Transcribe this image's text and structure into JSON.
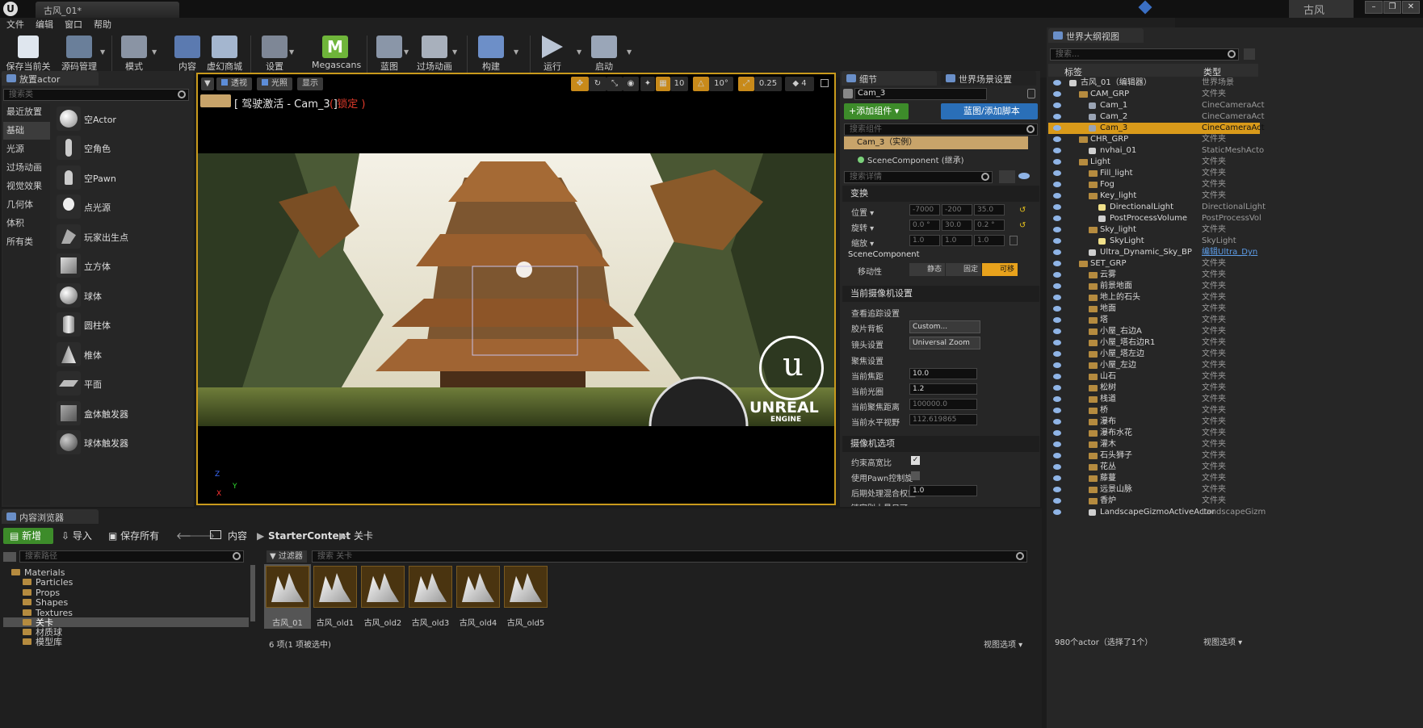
{
  "window": {
    "doc_tab": "古风_01*",
    "project_name": "古风"
  },
  "menu": [
    "文件",
    "编辑",
    "窗口",
    "帮助"
  ],
  "toolbar": [
    {
      "label": "保存当前关卡",
      "icon": "save-icon"
    },
    {
      "label": "源码管理",
      "icon": "source-control-icon"
    },
    {
      "label": "模式",
      "icon": "modes-icon"
    },
    {
      "label": "内容",
      "icon": "content-icon"
    },
    {
      "label": "虚幻商城",
      "icon": "marketplace-icon"
    },
    {
      "label": "设置",
      "icon": "settings-icon"
    },
    {
      "label": "Megascans",
      "icon": "megascans-icon"
    },
    {
      "label": "蓝图",
      "icon": "blueprint-icon"
    },
    {
      "label": "过场动画",
      "icon": "cinematics-icon"
    },
    {
      "label": "构建",
      "icon": "build-icon"
    },
    {
      "label": "运行",
      "icon": "play-icon"
    },
    {
      "label": "启动",
      "icon": "launch-icon"
    }
  ],
  "place_actor": {
    "tab": "放置actor",
    "search_placeholder": "搜索类",
    "categories": [
      "最近放置",
      "基础",
      "光源",
      "过场动画",
      "视觉效果",
      "几何体",
      "体积",
      "所有类"
    ],
    "actors": [
      "空Actor",
      "空角色",
      "空Pawn",
      "点光源",
      "玩家出生点",
      "立方体",
      "球体",
      "圆柱体",
      "椎体",
      "平面",
      "盒体触发器",
      "球体触发器"
    ]
  },
  "viewport": {
    "buttons": [
      "透视",
      "光照",
      "显示"
    ],
    "pilot_label": "[ 驾驶激活 - Cam_3 ]",
    "locked_label": "( 锁定 )",
    "grid_snap": "10",
    "rot_snap": "10°",
    "scale_snap": "0.25",
    "cam_speed": "4",
    "logo_text": "UNREAL",
    "logo_sub": "ENGINE",
    "axis_z": "Z",
    "axis_y": "Y",
    "axis_x": "X"
  },
  "details": {
    "tab_details": "细节",
    "tab_world": "世界场景设置",
    "name_value": "Cam_3",
    "add_component": "+添加组件 ▾",
    "blueprint_btn": "蓝图/添加脚本",
    "search_components": "搜索组件",
    "instance": "Cam_3（实例）",
    "scene_component": "SceneComponent (继承)",
    "search_details": "搜索详情",
    "transform": "变换",
    "position_label": "位置 ▾",
    "rotation_label": "旋转 ▾",
    "scale_label": "缩放 ▾",
    "pos": [
      "-7000",
      "-200",
      "35.0"
    ],
    "rot": [
      "0.0 °",
      "30.0",
      "0.2 °"
    ],
    "scale": [
      "1.0",
      "1.0",
      "1.0"
    ],
    "scene_comp_section": "SceneComponent",
    "mobility": "移动性",
    "mob_static": "静态",
    "mob_stationary": "固定",
    "mob_movable": "可移",
    "cam_settings": "当前摄像机设置",
    "lookat": "查看追踪设置",
    "filmback": "胶片背板",
    "filmback_val": "Custom...",
    "lens": "镜头设置",
    "lens_val": "Universal Zoom",
    "focus": "聚焦设置",
    "focal_len": "当前焦距",
    "focal_len_val": "10.0",
    "aperture": "当前光圈",
    "aperture_val": "1.2",
    "focus_dist": "当前聚焦距离",
    "focus_dist_val": "100000.0",
    "hfov": "当前水平视野",
    "hfov_val": "112.619865",
    "cam_options": "摄像机选项",
    "constrain": "约束高宽比",
    "use_pawn": "使用Pawn控制旋",
    "pp_blend": "后期处理混合权重",
    "pp_blend_val": "1.0",
    "cut_label": "链家别士量日可"
  },
  "outliner": {
    "tab": "世界大纲视图",
    "search_placeholder": "搜索...",
    "col_label": "标签",
    "col_type": "类型",
    "rows": [
      {
        "label": "古风_01（编辑器）",
        "type": "世界场景",
        "depth": 0,
        "kind": "world"
      },
      {
        "label": "CAM_GRP",
        "type": "文件夹",
        "depth": 1,
        "kind": "folder"
      },
      {
        "label": "Cam_1",
        "type": "CineCameraAct",
        "depth": 2,
        "kind": "camera"
      },
      {
        "label": "Cam_2",
        "type": "CineCameraAct",
        "depth": 2,
        "kind": "camera"
      },
      {
        "label": "Cam_3",
        "type": "CineCameraAct",
        "depth": 2,
        "kind": "camera",
        "selected": true
      },
      {
        "label": "CHR_GRP",
        "type": "文件夹",
        "depth": 1,
        "kind": "folder"
      },
      {
        "label": "nvhai_01",
        "type": "StaticMeshActo",
        "depth": 2,
        "kind": "mesh"
      },
      {
        "label": "Light",
        "type": "文件夹",
        "depth": 1,
        "kind": "folder"
      },
      {
        "label": "Fill_light",
        "type": "文件夹",
        "depth": 2,
        "kind": "folder"
      },
      {
        "label": "Fog",
        "type": "文件夹",
        "depth": 2,
        "kind": "folder"
      },
      {
        "label": "Key_light",
        "type": "文件夹",
        "depth": 2,
        "kind": "folder"
      },
      {
        "label": "DirectionalLight",
        "type": "DirectionalLight",
        "depth": 3,
        "kind": "light"
      },
      {
        "label": "PostProcessVolume",
        "type": "PostProcessVol",
        "depth": 3,
        "kind": "pp"
      },
      {
        "label": "Sky_light",
        "type": "文件夹",
        "depth": 2,
        "kind": "folder"
      },
      {
        "label": "SkyLight",
        "type": "SkyLight",
        "depth": 3,
        "kind": "light"
      },
      {
        "label": "Ultra_Dynamic_Sky_BP",
        "type": "编辑Ultra_Dyn",
        "depth": 2,
        "kind": "sphere",
        "link": true
      },
      {
        "label": "SET_GRP",
        "type": "文件夹",
        "depth": 1,
        "kind": "folder"
      },
      {
        "label": "云雾",
        "type": "文件夹",
        "depth": 2,
        "kind": "folder"
      },
      {
        "label": "前景地面",
        "type": "文件夹",
        "depth": 2,
        "kind": "folder"
      },
      {
        "label": "地上的石头",
        "type": "文件夹",
        "depth": 2,
        "kind": "folder"
      },
      {
        "label": "地面",
        "type": "文件夹",
        "depth": 2,
        "kind": "folder"
      },
      {
        "label": "塔",
        "type": "文件夹",
        "depth": 2,
        "kind": "folder"
      },
      {
        "label": "小屋_右边A",
        "type": "文件夹",
        "depth": 2,
        "kind": "folder"
      },
      {
        "label": "小屋_塔右边R1",
        "type": "文件夹",
        "depth": 2,
        "kind": "folder"
      },
      {
        "label": "小屋_塔左边",
        "type": "文件夹",
        "depth": 2,
        "kind": "folder"
      },
      {
        "label": "小屋_左边",
        "type": "文件夹",
        "depth": 2,
        "kind": "folder"
      },
      {
        "label": "山石",
        "type": "文件夹",
        "depth": 2,
        "kind": "folder"
      },
      {
        "label": "松树",
        "type": "文件夹",
        "depth": 2,
        "kind": "folder"
      },
      {
        "label": "栈道",
        "type": "文件夹",
        "depth": 2,
        "kind": "folder"
      },
      {
        "label": "桥",
        "type": "文件夹",
        "depth": 2,
        "kind": "folder"
      },
      {
        "label": "瀑布",
        "type": "文件夹",
        "depth": 2,
        "kind": "folder"
      },
      {
        "label": "瀑布水花",
        "type": "文件夹",
        "depth": 2,
        "kind": "folder"
      },
      {
        "label": "灌木",
        "type": "文件夹",
        "depth": 2,
        "kind": "folder"
      },
      {
        "label": "石头狮子",
        "type": "文件夹",
        "depth": 2,
        "kind": "folder"
      },
      {
        "label": "花丛",
        "type": "文件夹",
        "depth": 2,
        "kind": "folder"
      },
      {
        "label": "藤蔓",
        "type": "文件夹",
        "depth": 2,
        "kind": "folder"
      },
      {
        "label": "远景山脉",
        "type": "文件夹",
        "depth": 2,
        "kind": "folder"
      },
      {
        "label": "香炉",
        "type": "文件夹",
        "depth": 2,
        "kind": "folder"
      },
      {
        "label": "LandscapeGizmoActiveActor",
        "type": "LandscapeGizm",
        "depth": 2,
        "kind": "sphere"
      }
    ],
    "status": "980个actor（选择了1个）",
    "view_options": "视图选项 ▾"
  },
  "content_browser": {
    "tab": "内容浏览器",
    "new_btn": "新增",
    "import_btn": "导入",
    "save_all_btn": "保存所有",
    "breadcrumb": [
      "内容",
      "StarterContent",
      "关卡"
    ],
    "search_paths": "搜索路径",
    "filters": "过滤器",
    "search_levels": "搜索 关卡",
    "tree": [
      "Materials",
      "Particles",
      "Props",
      "Shapes",
      "Textures",
      "关卡",
      "材质球",
      "模型库"
    ],
    "assets": [
      "古风_01",
      "古风_old1",
      "古风_old2",
      "古风_old3",
      "古风_old4",
      "古风_old5"
    ],
    "status": "6 项(1 项被选中)",
    "view_options": "视图选项 ▾"
  },
  "colors": {
    "accent_orange": "#e8a21c",
    "selection_highlight": "#d99a1a",
    "viewport_border": "#c99a1c",
    "button_green": "#3d8c2a",
    "button_blue": "#2a6fb8"
  }
}
